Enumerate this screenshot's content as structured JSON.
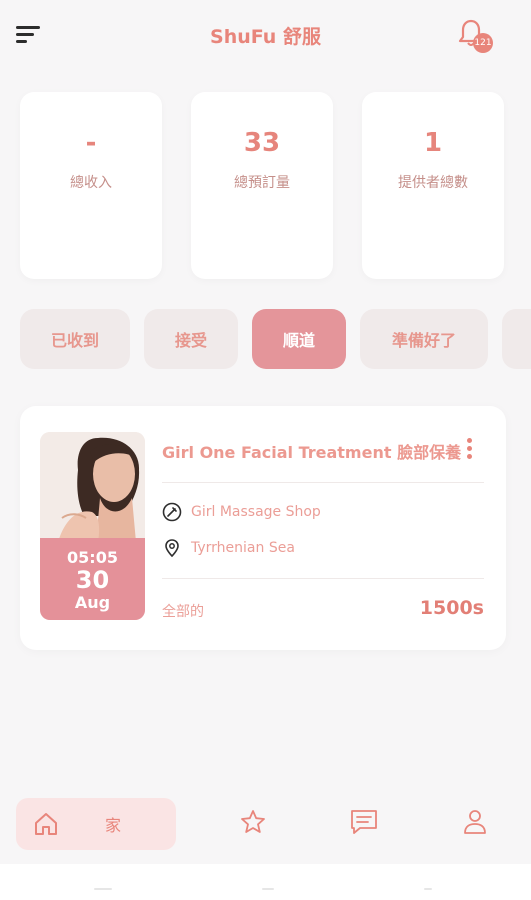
{
  "header": {
    "title": "ShuFu 舒服",
    "notification_count": "121"
  },
  "stats": [
    {
      "value": "-",
      "label": "總收入"
    },
    {
      "value": "33",
      "label": "總預訂量"
    },
    {
      "value": "1",
      "label": "提供者總數"
    }
  ],
  "tabs": [
    {
      "label": "已收到"
    },
    {
      "label": "接受"
    },
    {
      "label": "順道",
      "active": true
    },
    {
      "label": "準備好了"
    },
    {
      "label": ""
    }
  ],
  "booking": {
    "time": "05:05",
    "day": "30",
    "month": "Aug",
    "service_name": "Girl One Facial Treatment 臉部保養",
    "shop_name": "Girl Massage Shop",
    "location": "Tyrrhenian Sea",
    "status_label": "全部的",
    "price": "1500s"
  },
  "bottom_nav": {
    "home_label": "家"
  },
  "colors": {
    "accent": "#e8857b",
    "active_tab": "#e4959a",
    "background": "#f7f6f7"
  }
}
